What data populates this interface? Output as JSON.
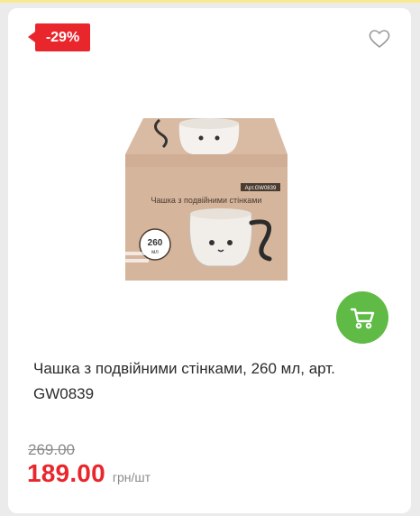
{
  "product": {
    "discount_label": "-29%",
    "title": "Чашка з подвійними стінками, 260 мл, арт. GW0839",
    "old_price": "269.00",
    "price": "189.00",
    "unit": "грн/шт",
    "image": {
      "box_text": "Чашка з подвійними стінками",
      "volume": "260",
      "volume_unit": "мл",
      "article": "Арт.GW0839"
    }
  },
  "icons": {
    "favorite": "heart-outline-icon",
    "cart": "cart-icon"
  },
  "colors": {
    "accent_red": "#e8262c",
    "cart_green": "#5fbb46",
    "background": "#ebebeb"
  }
}
